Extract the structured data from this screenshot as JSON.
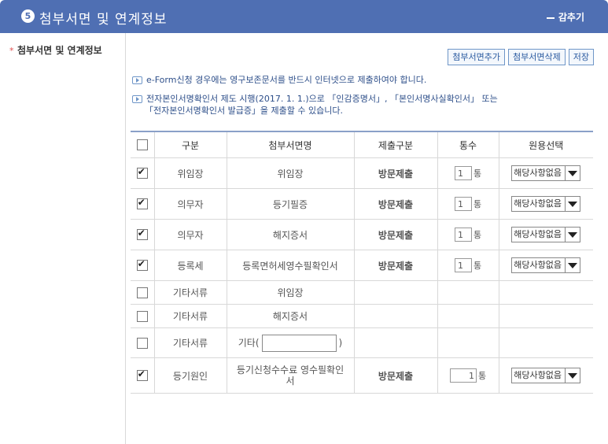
{
  "header": {
    "number": "5",
    "title": "첨부서면 및 연계정보",
    "collapse_label": "감추기"
  },
  "left": {
    "required_mark": "*",
    "label": "첨부서면 및 연계정보"
  },
  "buttons": {
    "add": "첨부서면추가",
    "delete": "첨부서면삭제",
    "save": "저장"
  },
  "notes": [
    "e-Form신청 경우에는 영구보존문서를 반드시 인터넷으로 제출하여야 합니다.",
    "전자본인서명확인서 제도 시행(2017. 1. 1.)으로 「인감증명서」, 「본인서명사실확인서」 또는",
    "「전자본인서명확인서 발급증」을 제출할 수 있습니다."
  ],
  "table": {
    "headers": [
      "구분",
      "첨부서면명",
      "제출구분",
      "통수",
      "원용선택"
    ],
    "unit": "통",
    "rows": [
      {
        "checked": true,
        "category": "위임장",
        "doc": "위임장",
        "submit": "방문제출",
        "count": "1",
        "select": "해당사항없음"
      },
      {
        "checked": true,
        "category": "의무자",
        "doc": "등기필증",
        "submit": "방문제출",
        "count": "1",
        "select": "해당사항없음"
      },
      {
        "checked": true,
        "category": "의무자",
        "doc": "해지증서",
        "submit": "방문제출",
        "count": "1",
        "select": "해당사항없음"
      },
      {
        "checked": true,
        "category": "등록세",
        "doc": "등록면허세영수필확인서",
        "submit": "방문제출",
        "count": "1",
        "select": "해당사항없음"
      },
      {
        "checked": false,
        "category": "기타서류",
        "doc": "위임장"
      },
      {
        "checked": false,
        "category": "기타서류",
        "doc": "해지증서"
      },
      {
        "checked": false,
        "category": "기타서류",
        "doc_prefix": "기타(",
        "doc_suffix": ")"
      },
      {
        "checked": true,
        "category": "등기원인",
        "doc": "등기신청수수료 영수필확인서",
        "submit": "방문제출",
        "count": "1",
        "select": "해당사항없음"
      }
    ]
  }
}
